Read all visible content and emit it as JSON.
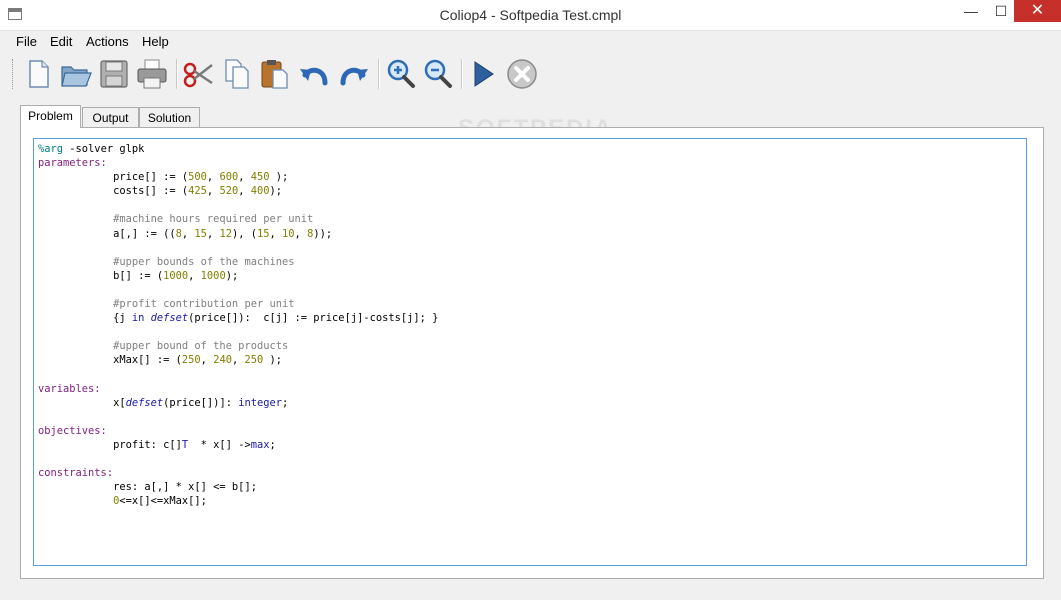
{
  "window": {
    "title": "Coliop4 - Softpedia Test.cmpl"
  },
  "menu": [
    "File",
    "Edit",
    "Actions",
    "Help"
  ],
  "toolbar": {
    "watermark": "SOFTPEDIA",
    "buttons": [
      "new-file",
      "open-folder",
      "save",
      "print",
      "cut",
      "copy",
      "paste",
      "undo",
      "redo",
      "zoom-in",
      "zoom-out",
      "run",
      "stop"
    ]
  },
  "tabs": [
    "Problem",
    "Output",
    "Solution"
  ],
  "editor": {
    "lines": [
      [
        [
          "arg",
          "%arg"
        ],
        [
          "t",
          " -solver glpk"
        ]
      ],
      [
        [
          "kw",
          "parameters:"
        ]
      ],
      [
        [
          "t",
          "            price[] := ("
        ],
        [
          "num",
          "500"
        ],
        [
          "t",
          ", "
        ],
        [
          "num",
          "600"
        ],
        [
          "t",
          ", "
        ],
        [
          "num",
          "450"
        ],
        [
          "t",
          " );"
        ]
      ],
      [
        [
          "t",
          "            costs[] := ("
        ],
        [
          "num",
          "425"
        ],
        [
          "t",
          ", "
        ],
        [
          "num",
          "520"
        ],
        [
          "t",
          ", "
        ],
        [
          "num",
          "400"
        ],
        [
          "t",
          ");"
        ]
      ],
      [],
      [
        [
          "cm",
          "            #machine hours required per unit"
        ]
      ],
      [
        [
          "t",
          "            a[,] := (("
        ],
        [
          "num",
          "8"
        ],
        [
          "t",
          ", "
        ],
        [
          "num",
          "15"
        ],
        [
          "t",
          ", "
        ],
        [
          "num",
          "12"
        ],
        [
          "t",
          "), ("
        ],
        [
          "num",
          "15"
        ],
        [
          "t",
          ", "
        ],
        [
          "num",
          "10"
        ],
        [
          "t",
          ", "
        ],
        [
          "num",
          "8"
        ],
        [
          "t",
          "));"
        ]
      ],
      [],
      [
        [
          "cm",
          "            #upper bounds of the machines"
        ]
      ],
      [
        [
          "t",
          "            b[] := ("
        ],
        [
          "num",
          "1000"
        ],
        [
          "t",
          ", "
        ],
        [
          "num",
          "1000"
        ],
        [
          "t",
          ");"
        ]
      ],
      [],
      [
        [
          "cm",
          "            #profit contribution per unit"
        ]
      ],
      [
        [
          "t",
          "            {j "
        ],
        [
          "bl",
          "in"
        ],
        [
          "t",
          " "
        ],
        [
          "it",
          "defset"
        ],
        [
          "t",
          "(price[]):  c[j] := price[j]-costs[j]; }"
        ]
      ],
      [],
      [
        [
          "cm",
          "            #upper bound of the products"
        ]
      ],
      [
        [
          "t",
          "            xMax[] := ("
        ],
        [
          "num",
          "250"
        ],
        [
          "t",
          ", "
        ],
        [
          "num",
          "240"
        ],
        [
          "t",
          ", "
        ],
        [
          "num",
          "250"
        ],
        [
          "t",
          " );"
        ]
      ],
      [],
      [
        [
          "kw",
          "variables:"
        ]
      ],
      [
        [
          "t",
          "            x["
        ],
        [
          "it",
          "defset"
        ],
        [
          "t",
          "(price[])]: "
        ],
        [
          "bl",
          "integer"
        ],
        [
          "t",
          ";"
        ]
      ],
      [],
      [
        [
          "kw",
          "objectives:"
        ]
      ],
      [
        [
          "t",
          "            profit: c[]"
        ],
        [
          "bl",
          "T"
        ],
        [
          "t",
          "  * x[] ->"
        ],
        [
          "bl",
          "max"
        ],
        [
          "t",
          ";"
        ]
      ],
      [],
      [
        [
          "kw",
          "constraints:"
        ]
      ],
      [
        [
          "t",
          "            res: a[,] * x[] <= b[];"
        ]
      ],
      [
        [
          "t",
          "            "
        ],
        [
          "num",
          "0"
        ],
        [
          "t",
          "<=x[]<=xMax[];"
        ]
      ]
    ]
  }
}
